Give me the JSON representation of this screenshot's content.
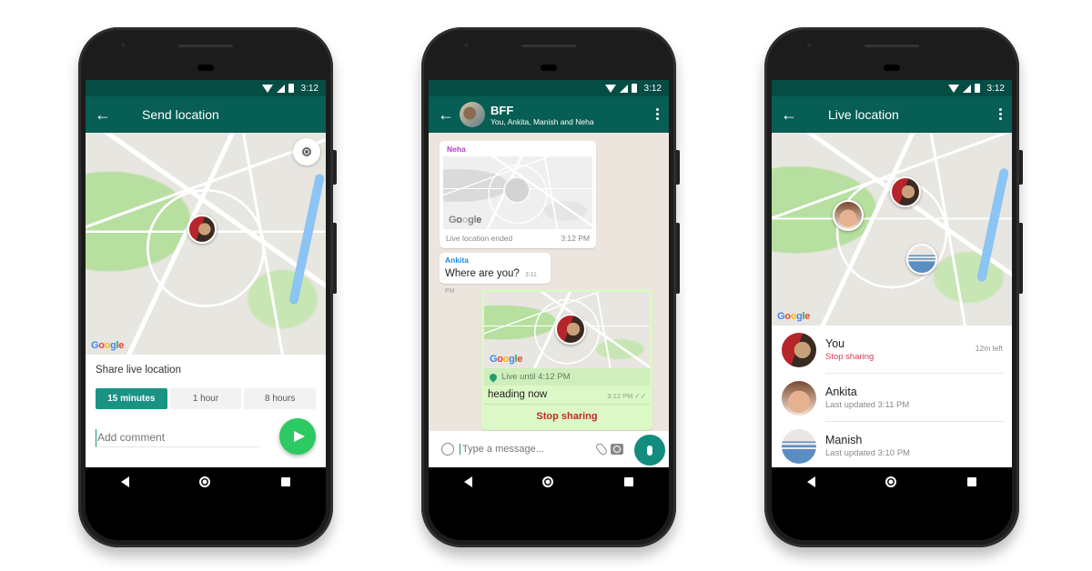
{
  "status_bar": {
    "time": "3:12"
  },
  "phone1": {
    "title": "Send location",
    "share_label": "Share live location",
    "durations": [
      {
        "label": "15 minutes",
        "selected": true
      },
      {
        "label": "1 hour",
        "selected": false
      },
      {
        "label": "8 hours",
        "selected": false
      }
    ],
    "comment_placeholder": "Add comment",
    "map_attribution": "Google"
  },
  "phone2": {
    "chat_title": "BFF",
    "chat_subtitle": "You, Ankita, Manish and Neha",
    "messages": [
      {
        "sender": "Neha",
        "type": "location",
        "status": "Live location ended",
        "time": "3:12 PM"
      },
      {
        "sender": "Ankita",
        "type": "text",
        "text": "Where are you?",
        "time": "3:11 PM"
      },
      {
        "sender": "You",
        "type": "live-location",
        "live_until": "Live until 4:12 PM",
        "text": "heading now",
        "time": "3:12 PM",
        "action": "Stop sharing"
      }
    ],
    "composer_placeholder": "Type a message...",
    "map_attribution": "Google"
  },
  "phone3": {
    "title": "Live location",
    "participants": [
      {
        "name": "You",
        "subtitle": "Stop sharing",
        "remaining": "12m left"
      },
      {
        "name": "Ankita",
        "subtitle": "Last updated 3:11 PM"
      },
      {
        "name": "Manish",
        "subtitle": "Last updated 3:10 PM"
      }
    ],
    "map_attribution": "Google"
  },
  "colors": {
    "header": "#075e54",
    "status_bar": "#054d44",
    "accent": "#1a9383",
    "send_fab": "#2dc962",
    "stop_sharing": "#c62828",
    "outgoing_bubble": "#dcf8c6",
    "chat_background": "#ece5dd"
  }
}
